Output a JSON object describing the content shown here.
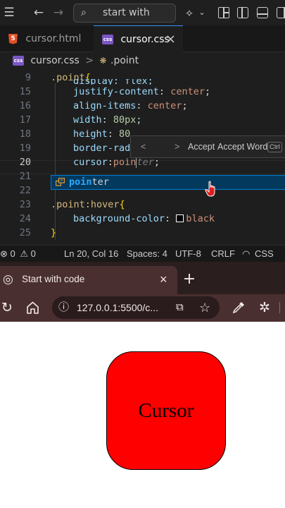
{
  "titlebar": {
    "search_text": "start with code",
    "icons": [
      "menu-icon",
      "back-arrow-icon",
      "forward-arrow-icon",
      "search-icon",
      "copilot-icon",
      "chevron-down-icon",
      "layout-icon",
      "toggle-sidebar-icon",
      "toggle-panel-icon",
      "toggle-secondary-sidebar-icon"
    ]
  },
  "tabs": [
    {
      "label": "cursor.html",
      "icon": "html5-icon",
      "badge": "5",
      "active": false
    },
    {
      "label": "cursor.css",
      "icon": "css-icon",
      "badge": "css",
      "active": true,
      "close": "×"
    }
  ],
  "breadcrumb": {
    "file": "cursor.css",
    "badge": "css",
    "separator": ">",
    "symbol_icon": "css-selector-icon",
    "symbol": ".point"
  },
  "code": {
    "lines": [
      {
        "n": "9",
        "parts": [
          {
            "t": ".point",
            "c": "sel"
          },
          {
            "t": "{",
            "c": "brace"
          }
        ],
        "indent": false
      },
      {
        "n": "15",
        "parts": [
          {
            "t": "justify-content",
            "c": "prop"
          },
          {
            "t": ": ",
            "c": ""
          },
          {
            "t": "center",
            "c": "val"
          },
          {
            "t": ";",
            "c": ""
          }
        ],
        "indent": true
      },
      {
        "n": "16",
        "parts": [
          {
            "t": "align-items",
            "c": "prop"
          },
          {
            "t": ": ",
            "c": ""
          },
          {
            "t": "center",
            "c": "val"
          },
          {
            "t": ";",
            "c": ""
          }
        ],
        "indent": true
      },
      {
        "n": "17",
        "parts": [
          {
            "t": "width",
            "c": "prop"
          },
          {
            "t": ": ",
            "c": ""
          },
          {
            "t": "80px",
            "c": "num"
          },
          {
            "t": ";",
            "c": ""
          }
        ],
        "indent": true
      },
      {
        "n": "18",
        "parts": [
          {
            "t": "height",
            "c": "prop"
          },
          {
            "t": ": ",
            "c": ""
          },
          {
            "t": "80",
            "c": "num"
          }
        ],
        "indent": true
      },
      {
        "n": "19",
        "parts": [
          {
            "t": "border-rad",
            "c": "prop"
          }
        ],
        "indent": true
      },
      {
        "n": "20",
        "parts": [
          {
            "t": "cursor",
            "c": "prop"
          },
          {
            "t": ":",
            "c": ""
          },
          {
            "t": "poin",
            "c": "val"
          },
          {
            "t": "|",
            "c": "caret"
          },
          {
            "t": "ter",
            "c": "ghost"
          },
          {
            "t": ";",
            "c": ""
          }
        ],
        "indent": true,
        "current": true
      },
      {
        "n": "21",
        "parts": [],
        "indent": false
      },
      {
        "n": "22",
        "parts": [],
        "indent": false
      },
      {
        "n": "23",
        "parts": [
          {
            "t": ".point:hover",
            "c": "sel"
          },
          {
            "t": "{",
            "c": "brace"
          }
        ],
        "indent": false
      },
      {
        "n": "24",
        "parts": [
          {
            "t": "background-color",
            "c": "prop"
          },
          {
            "t": ": ",
            "c": ""
          },
          {
            "t": "swatch",
            "c": "swatch"
          },
          {
            "t": "black",
            "c": "val"
          }
        ],
        "indent": true
      },
      {
        "n": "25",
        "parts": [
          {
            "t": "}",
            "c": "brace"
          }
        ],
        "indent": false
      }
    ],
    "partial_line_text": "display: flex;"
  },
  "inline_suggestion": {
    "prev": "<",
    "next": ">",
    "accept": "Accept",
    "accept_word": "Accept Word",
    "shortcut": "Ctrl"
  },
  "suggest": {
    "icon": "enum-value-icon",
    "match": "poin",
    "rest": "ter"
  },
  "statusbar": {
    "errors": "0",
    "warnings": "0",
    "position": "Ln 20, Col 16",
    "spaces": "Spaces: 4",
    "encoding": "UTF-8",
    "eol": "CRLF",
    "language": "CSS"
  },
  "browser": {
    "tab_title": "Start with code",
    "tab_close": "×",
    "new_tab": "+",
    "url": "127.0.0.1:5500/c...",
    "icons": [
      "globe-icon",
      "reload-icon",
      "home-icon",
      "info-icon",
      "app-available-icon",
      "favorite-star-icon",
      "eyedropper-icon",
      "extensions-icon"
    ]
  },
  "page": {
    "box_text": "Cursor",
    "box_color": "#ff0000"
  },
  "colors": {
    "accent": "#3794ff",
    "editor_bg": "#1e1e1e",
    "browser_bg": "#4a2f30"
  }
}
